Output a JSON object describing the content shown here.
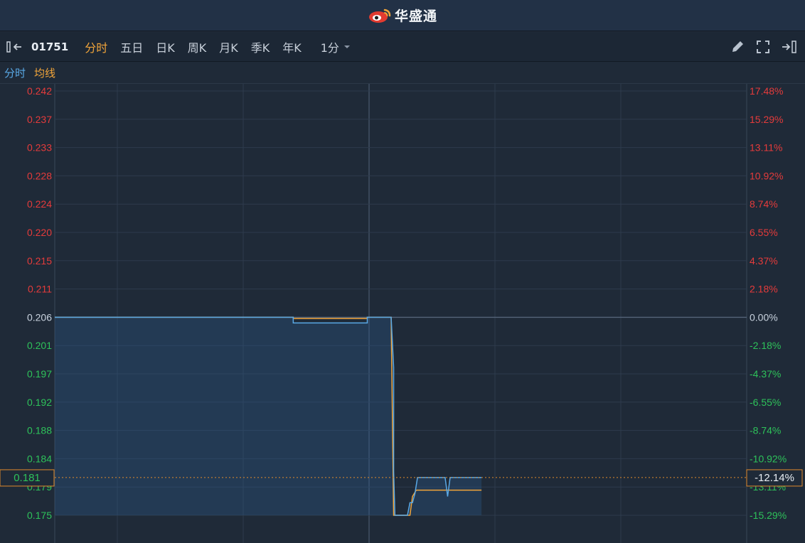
{
  "header": {
    "brand": "华盛通"
  },
  "toolbar": {
    "stock_code": "01751",
    "periods": [
      "分时",
      "五日",
      "日K",
      "周K",
      "月K",
      "季K",
      "年K"
    ],
    "active_period": "分时",
    "interval": "1分"
  },
  "legend": {
    "line1": "分时",
    "line2": "均线"
  },
  "colors": {
    "up": "#e53b3b",
    "down": "#2ec25a",
    "neutral": "#c8d2de",
    "price_line": "#5aa9e6",
    "avg_line": "#f2a53a"
  },
  "chart_data": {
    "type": "line",
    "prev_close": 0.206,
    "ylim": [
      0.173,
      0.242
    ],
    "price_ticks": [
      "0.242",
      "0.237",
      "0.233",
      "0.228",
      "0.224",
      "0.220",
      "0.215",
      "0.211",
      "0.206",
      "0.201",
      "0.197",
      "0.192",
      "0.188",
      "0.184",
      "0.179",
      "0.175"
    ],
    "price_tick_values": [
      0.242,
      0.2375,
      0.233,
      0.2285,
      0.224,
      0.2195,
      0.215,
      0.2105,
      0.206,
      0.2015,
      0.197,
      0.1925,
      0.188,
      0.1835,
      0.179,
      0.1745
    ],
    "pct_ticks": [
      "17.48%",
      "15.29%",
      "13.11%",
      "10.92%",
      "8.74%",
      "6.55%",
      "4.37%",
      "2.18%",
      "0.00%",
      "-2.18%",
      "-4.37%",
      "-6.55%",
      "-8.74%",
      "-10.92%",
      "-13.11%",
      "-15.29%"
    ],
    "current_price_label": "0.181",
    "current_pct_label": "-12.14%",
    "current_price": 0.1805,
    "total_minutes": 330,
    "series": [
      {
        "name": "分时",
        "points": [
          [
            0,
            0.206
          ],
          [
            190,
            0.206
          ],
          [
            190,
            0.2051
          ],
          [
            249,
            0.2051
          ],
          [
            249,
            0.206
          ],
          [
            268,
            0.206
          ],
          [
            270,
            0.198
          ],
          [
            270,
            0.1815
          ],
          [
            271,
            0.1745
          ],
          [
            281,
            0.1745
          ],
          [
            283,
            0.1765
          ],
          [
            285,
            0.1765
          ],
          [
            287,
            0.178
          ],
          [
            289,
            0.1805
          ],
          [
            311,
            0.1805
          ],
          [
            313,
            0.1775
          ],
          [
            315,
            0.1805
          ],
          [
            340,
            0.1805
          ]
        ]
      },
      {
        "name": "均线",
        "points": [
          [
            0,
            0.206
          ],
          [
            190,
            0.206
          ],
          [
            190,
            0.2058
          ],
          [
            249,
            0.2058
          ],
          [
            249,
            0.206
          ],
          [
            268,
            0.206
          ],
          [
            270,
            0.1745
          ],
          [
            283,
            0.1745
          ],
          [
            285,
            0.1775
          ],
          [
            288,
            0.1785
          ],
          [
            340,
            0.1785
          ]
        ]
      }
    ]
  }
}
